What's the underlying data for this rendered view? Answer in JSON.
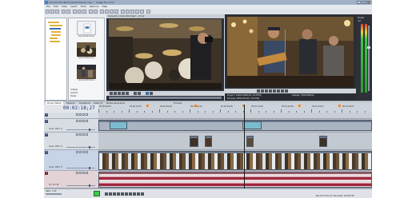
{
  "window": {
    "title": "Concert-Full-Band_Performance.veg * - Vegas Pro 13.0",
    "controls": [
      "_",
      "□",
      "x"
    ]
  },
  "menu": [
    "File",
    "Edit",
    "View",
    "Insert",
    "Tools",
    "Options",
    "Help"
  ],
  "explorer": {
    "files": [
      {
        "name": "Concert-01.mov"
      },
      {
        "name": "Concert-02.mov"
      },
      {
        "name": "Concert-03.mov"
      }
    ],
    "info_lines": [
      "(Video)",
      "(Audio)",
      "(Size)"
    ]
  },
  "trimmer": {
    "title": "Concert_1.mov (trimmer) - [1:1]"
  },
  "preview": {
    "project_line": "Project: 1920x1080x32, 29.970p",
    "preview_line": "Preview: 480x270x32, 29.970p",
    "display_line": "Display: 532x299x32"
  },
  "meters": {
    "label": "Master",
    "scale": "-Inf."
  },
  "tabs": [
    "Project Media",
    "Explorer",
    "Transitions",
    "Video FX",
    "Media Generators",
    "Trimmer"
  ],
  "timeline": {
    "timecode": "00:02:18;27",
    "ruler_labels": [
      "00:00:00;00",
      "00:00:15;00",
      "00:00:29;29",
      "00:00:44;29",
      "00:00:59;28",
      "00:01:14;28",
      "00:01:29;28",
      "00:01:44;27",
      "00:01:59;27"
    ],
    "tracks": [
      {
        "num": "1",
        "type": "video",
        "level": "Level: 100.0 %"
      },
      {
        "num": "2",
        "type": "video",
        "level": "Level: 100.0 %"
      },
      {
        "num": "3",
        "type": "video",
        "level": "Level: 100.0 %"
      },
      {
        "num": "4",
        "type": "video",
        "level": "Level: 100.0 %"
      },
      {
        "num": "5",
        "type": "audio",
        "level": "Vol: 0.0 dB"
      }
    ]
  },
  "status": {
    "rate": "Rate: 1.00",
    "right": "Record Time (2 channels): 129:43:25"
  },
  "colors": {
    "accent_blue": "#3c6fb4",
    "video_header": "#3a4f78",
    "audio_header": "#7a2036",
    "waveform": "#a0263f",
    "meter_green": "#3fc94a"
  }
}
